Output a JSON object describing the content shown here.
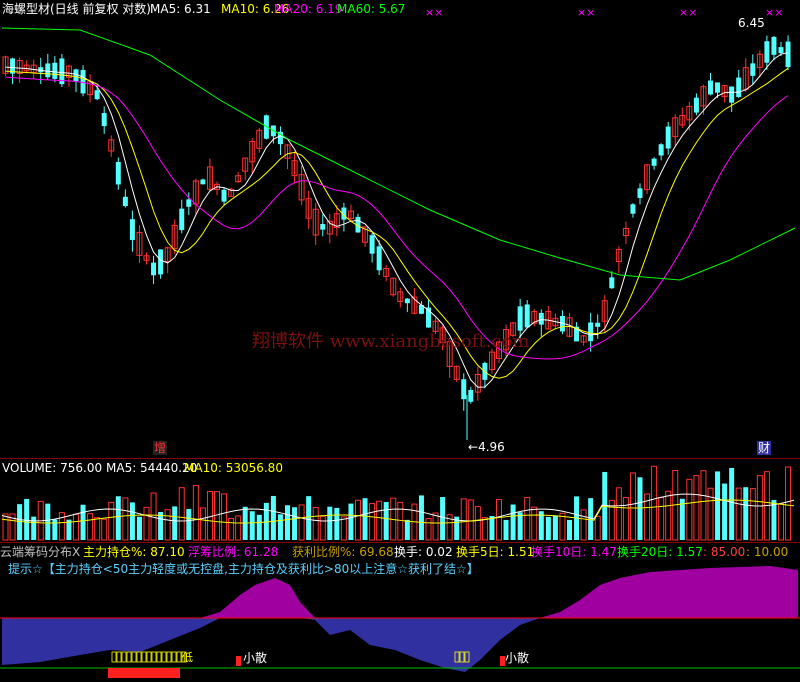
{
  "header": {
    "stock_title": "海螺型材(日线 前复权 对数)",
    "ma": [
      {
        "label": "MA5: 6.31",
        "color": "#ffffff"
      },
      {
        "label": "MA10: 6.26",
        "color": "#ffff00"
      },
      {
        "label": "MA20: 6.19",
        "color": "#ff00ff"
      },
      {
        "label": "MA60: 5.67",
        "color": "#00ff00"
      }
    ]
  },
  "price_panel": {
    "high_label": "6.45",
    "low_label": "4.96",
    "marker_zeng": "增",
    "marker_cai": "财",
    "watermark": "翔博软件 www.xiangbosoft.com",
    "top_marks": [
      "××",
      "××",
      "××",
      "××"
    ]
  },
  "volume_header": {
    "volume_label": "VOLUME: 756.00",
    "ma5_label": "MA5: 54440.20",
    "ma10_label": "MA10: 53056.80"
  },
  "chip_header": {
    "name": "云端筹码分布X",
    "items": [
      {
        "label": "主力持仓%: 87.10",
        "color": "#ffff00"
      },
      {
        "label": "浮筹比例: 61.28",
        "color": "#ff00ff"
      },
      {
        "label": "获利比例%: 69.68",
        "color": "#c8a000"
      },
      {
        "label": "换手: 0.02",
        "color": "#ffffff"
      },
      {
        "label": "换手5日: 1.51",
        "color": "#ffff00"
      },
      {
        "label": "换手10日: 1.47",
        "color": "#ff00ff"
      },
      {
        "label": "换手20日: 1.57",
        "color": "#00ff00"
      },
      {
        "label": ": 85.00",
        "color": "#ff4040"
      },
      {
        "label": ": 10.00",
        "color": "#c8a000"
      }
    ]
  },
  "hint_text": "提示☆【主力持仓<50主力轻度或无控盘,主力持仓及获利比>80以上注意☆获利了结☆】",
  "indicator_panel": {
    "label_di": "低",
    "label_xiaosan": "小散"
  },
  "colors": {
    "up": "#ff3232",
    "down": "#54ffff",
    "ma5": "#ffffff",
    "ma10": "#ffff00",
    "ma20": "#ff00ff",
    "ma60": "#00ff00",
    "purple_fill": "#a000a0",
    "blue_fill": "#3030a0"
  },
  "chart_data": {
    "type": "candlestick",
    "price_scale": "log",
    "price_extremes": {
      "high": 6.45,
      "low": 4.96
    },
    "last_values": {
      "ma5": 6.31,
      "ma10": 6.26,
      "ma20": 6.19,
      "ma60": 5.67,
      "volume": 756.0,
      "volume_ma5": 54440.2,
      "volume_ma10": 53056.8,
      "main_holding_pct": 87.1,
      "floating_chip_ratio": 61.28,
      "profit_ratio_pct": 69.68,
      "turnover": 0.02,
      "turnover_5d": 1.51,
      "turnover_10d": 1.47,
      "turnover_20d": 1.57
    }
  }
}
